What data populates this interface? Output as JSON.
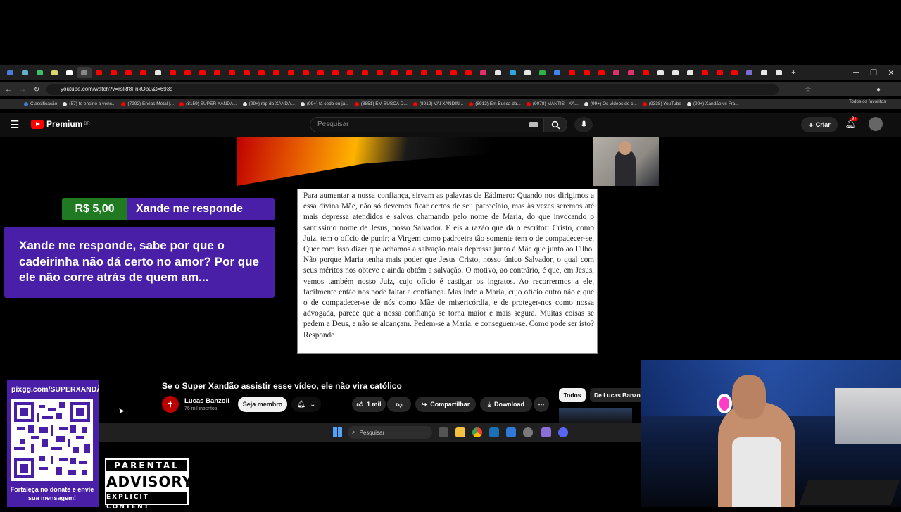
{
  "browser": {
    "url": "youtube.com/watch?v=rsRf8FnxOb0&t=693s",
    "bookmarks": [
      {
        "label": "Classificação",
        "color": "#4a7bd8"
      },
      {
        "label": "(57) te ensino a venc...",
        "color": "#e6e6e6"
      },
      {
        "label": "(7292) Enéas Metal |...",
        "color": "#ff0000"
      },
      {
        "label": "(8159) SUPER XANDÃ...",
        "color": "#ff0000"
      },
      {
        "label": "(99+) rap do XANDÃ...",
        "color": "#e6e6e6"
      },
      {
        "label": "(99+) tá cedo ou já...",
        "color": "#e6e6e6"
      },
      {
        "label": "(8851) EM BUSCA D...",
        "color": "#ff0000"
      },
      {
        "label": "(8912) VAI XANDIN...",
        "color": "#ff0000"
      },
      {
        "label": "(8912) Em Busca da...",
        "color": "#ff0000"
      },
      {
        "label": "(9078) MANTIS - XA...",
        "color": "#ff0000"
      },
      {
        "label": "(99+) Os vídeos de c...",
        "color": "#e6e6e6"
      },
      {
        "label": "(9338) YouTube",
        "color": "#ff0000"
      },
      {
        "label": "(99+) Xandão vs Fra...",
        "color": "#e6e6e6"
      }
    ],
    "favorites_label": "Todos os favoritos",
    "tab_colors": [
      "#4a7bd8",
      "#5fb0c8",
      "#3cc06a",
      "#dcd76c",
      "#ffffff",
      "#888888",
      "#ff0000",
      "#ff0000",
      "#ff0000",
      "#ff0000",
      "#e6e6e6",
      "#ff0000",
      "#ff0000",
      "#ff0000",
      "#ff0000",
      "#ff0000",
      "#ff0000",
      "#ff0000",
      "#ff0000",
      "#ff0000",
      "#ff0000",
      "#ff0000",
      "#ff0000",
      "#ff0000",
      "#ff0000",
      "#ff0000",
      "#ff0000",
      "#ff0000",
      "#ff0000",
      "#ff0000",
      "#ff0000",
      "#ff0000",
      "#e1306c",
      "#e6e6e6",
      "#2ca5e0",
      "#e6e6e6",
      "#2db34a",
      "#4285f4",
      "#ff0000",
      "#ff0000",
      "#ff0000",
      "#e1306c",
      "#e1306c",
      "#ff0000",
      "#e6e6e6",
      "#e6e6e6",
      "#e6e6e6",
      "#ff0000",
      "#ff0000",
      "#ff0000",
      "#7b6cd8",
      "#e6e6e6",
      "#e6e6e6"
    ]
  },
  "youtube": {
    "logo_text": "Premium",
    "logo_region": "BR",
    "search_placeholder": "Pesquisar",
    "create_label": "Criar",
    "notif_badge": "9+",
    "video_title": "Se o Super Xandão assistir esse vídeo, ele não vira católico",
    "channel_name": "Lucas Banzoli",
    "channel_subs": "76 mil inscritos",
    "member_label": "Seja membro",
    "likes": "1 mil",
    "share_label": "Compartilhar",
    "download_label": "Download",
    "chip_all": "Todos",
    "chip_from": "De Lucas Banzoli"
  },
  "book_text": "Para aumentar a nossa confiança, sirvam as palavras de Eádmero: Quando nos dirigimos a essa divina Mãe, não só devemos ficar certos de seu patrocínio, mas às vezes seremos até mais depressa atendidos e salvos chamando pelo nome de Maria, do que invocando o santíssimo nome de Jesus, nosso Salvador. E eis a razão que dá o escritor: Cristo, como Juiz, tem o ofício de punir; a Virgem como padroeira tão somente tem o de compadecer-se. Quer com isso dizer que achamos a salvação mais depressa junto à Mãe que junto ao Filho. Não porque Maria tenha mais poder que Jesus Cristo, nosso único Salvador, o qual com seus méritos nos obteve e ainda obtém a salvação. O motivo, ao contrário, é que, em Jesus, vemos também nosso Juiz, cujo ofício é castigar os ingratos. Ao recorrermos a ele, facilmente então nos pode faltar a confiança. Mas indo a Maria, cujo ofício outro não é que o de compadecer-se de nós como Mãe de misericórdia, e de proteger-nos como nossa advogada, parece que a nossa confiança se torna maior e mais segura. Muitas coisas se pedem a Deus, e não se alcançam. Pedem-se a Maria, e conseguem-se. Como pode ser isto? Responde",
  "donation": {
    "amount": "R$ 5,00",
    "name": "Xande me responde",
    "message": "Xande me responde, sabe por que o cadeirinha não dá certo no amor? Por que ele não corre atrás de quem am..."
  },
  "pix": {
    "url": "pixgg.com/SUPERXANDÃO",
    "caption": "Fortaleça no donate e envie sua mensagem!"
  },
  "advisory": {
    "top": "PARENTAL",
    "middle": "ADVISORY",
    "bottom": "EXPLICIT CONTENT"
  },
  "taskbar": {
    "search_label": "Pesquisar"
  }
}
